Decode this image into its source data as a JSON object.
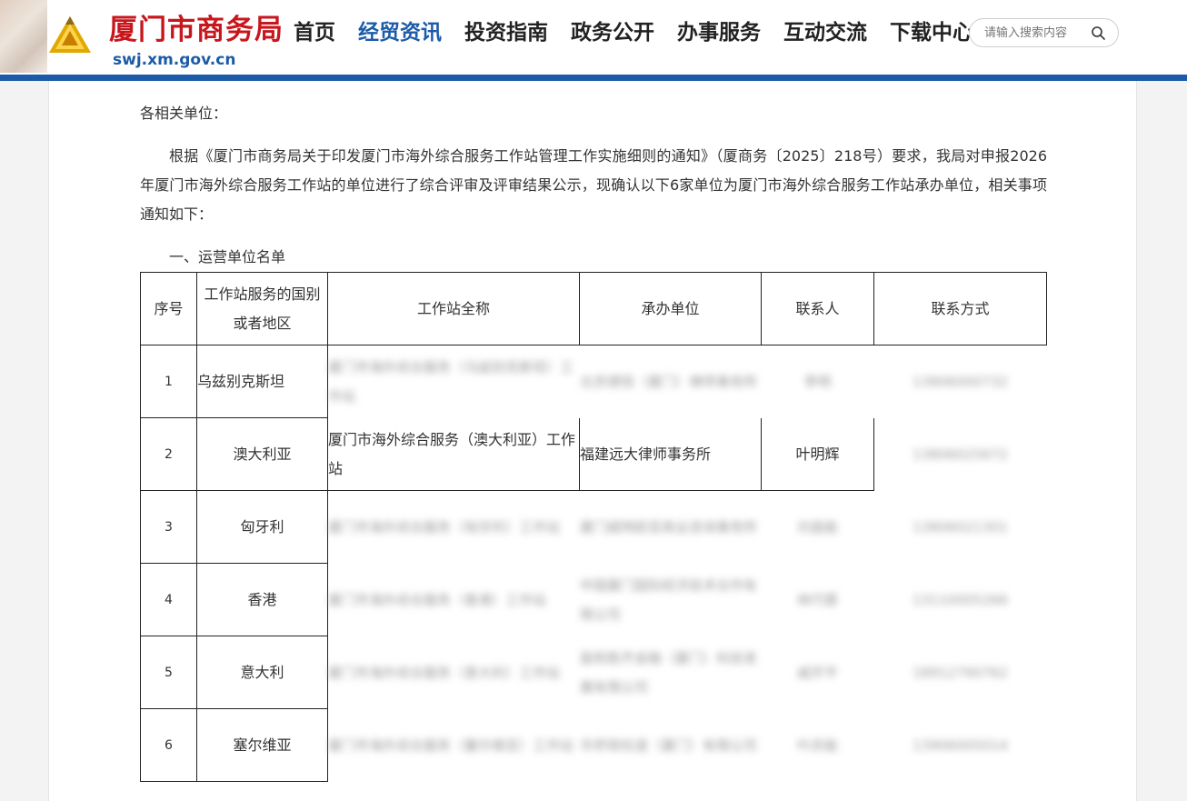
{
  "header": {
    "site_title": "厦门市商务局",
    "domain": "swj.xm.gov.cn",
    "nav": [
      {
        "label": "首页",
        "active": false
      },
      {
        "label": "经贸资讯",
        "active": true
      },
      {
        "label": "投资指南",
        "active": false
      },
      {
        "label": "政务公开",
        "active": false
      },
      {
        "label": "办事服务",
        "active": false
      },
      {
        "label": "互动交流",
        "active": false
      },
      {
        "label": "下载中心",
        "active": false
      }
    ],
    "search_placeholder": "请输入搜索内容"
  },
  "article": {
    "greeting": "各相关单位：",
    "body": "根据《厦门市商务局关于印发厦门市海外综合服务工作站管理工作实施细则的通知》（厦商务〔2025〕218号）要求，我局对申报2026年厦门市海外综合服务工作站的单位进行了综合评审及评审结果公示，现确认以下6家单位为厦门市海外综合服务工作站承办单位，相关事项通知如下：",
    "section_title": "一、运营单位名单",
    "table": {
      "headers": [
        "序号",
        "工作站服务的国别或者地区",
        "工作站全称",
        "承办单位",
        "联系人",
        "联系方式"
      ],
      "rows": [
        [
          "1",
          "乌兹别克斯坦",
          "厦门市海外综合服务（乌兹别克斯坦）工作站",
          "北京德恒（厦门）律师事务所",
          "李明",
          "13806000732"
        ],
        [
          "2",
          "澳大利亚",
          "厦门市海外综合服务（澳大利亚）工作站",
          "福建远大律师事务所",
          "叶明辉",
          "13806025672"
        ],
        [
          "3",
          "匈牙利",
          "厦门市海外综合服务（匈牙利）工作站",
          "厦门威特欧亚商业咨询事务所",
          "刘昌能",
          "13806021301"
        ],
        [
          "4",
          "香港",
          "厦门市海外综合服务（香港）工作站",
          "中国厦门国际经济技术合作有限公司",
          "林巧蓉",
          "13110005266"
        ],
        [
          "5",
          "意大利",
          "厦门市海外综合服务（意大利）工作站",
          "盈和胜齐金融（厦门）科技发展有限公司",
          "戚开平",
          "18912790762"
        ],
        [
          "6",
          "塞尔维亚",
          "厦门市海外综合服务（塞尔维亚）工作站",
          "华侨铁柱道（厦门）有限公司",
          "叶庆能",
          "13906005014"
        ]
      ]
    }
  },
  "colors": {
    "brand_red": "#c8161d",
    "brand_blue": "#1c5ba8"
  },
  "icons": {
    "logo": "triangle-emblem-icon",
    "search": "search-icon"
  }
}
